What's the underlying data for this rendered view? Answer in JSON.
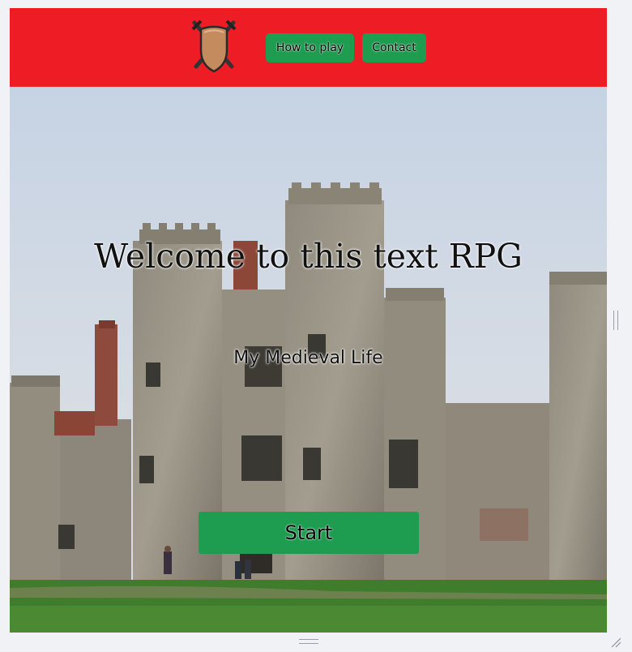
{
  "nav": {
    "logo_icon": "shield-crossed-swords-icon",
    "how_to_play": "How to play",
    "contact": "Contact",
    "background_color": "#ee1c25",
    "button_color": "#1e9c4f"
  },
  "hero": {
    "title": "Welcome to this text RPG",
    "subtitle": "My Medieval Life",
    "start_label": "Start",
    "background_image": "medieval-castle-photo"
  }
}
